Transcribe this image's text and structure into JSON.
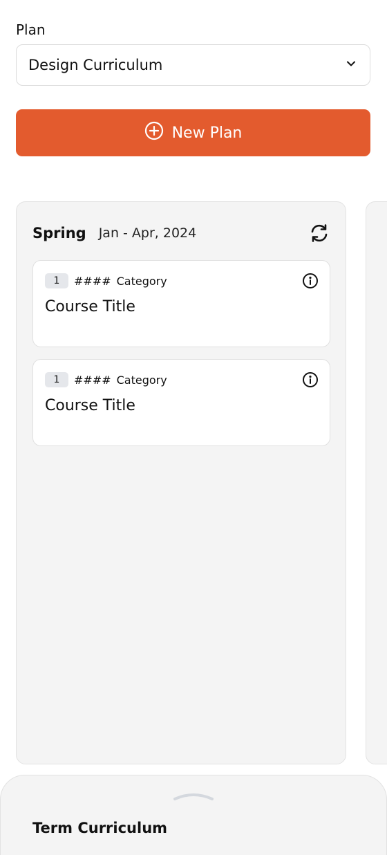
{
  "plan": {
    "label": "Plan",
    "selected": "Design Curriculum",
    "new_plan_label": "New Plan"
  },
  "terms": [
    {
      "season": "Spring",
      "dates": "Jan - Apr, 2024",
      "courses": [
        {
          "credits": "1",
          "code": "####",
          "category": "Category",
          "title": "Course Title"
        },
        {
          "credits": "1",
          "code": "####",
          "category": "Category",
          "title": "Course Title"
        }
      ]
    }
  ],
  "bottom_sheet": {
    "title": "Term Curriculum"
  },
  "colors": {
    "accent": "#e35b2e",
    "panel_bg": "#f4f4f4",
    "badge_bg": "#e5e7eb"
  },
  "icons": {
    "dropdown": "chevron-down-icon",
    "new_plan": "plus-circle-icon",
    "refresh": "refresh-icon",
    "info": "info-icon",
    "handle": "chevron-up-icon"
  }
}
